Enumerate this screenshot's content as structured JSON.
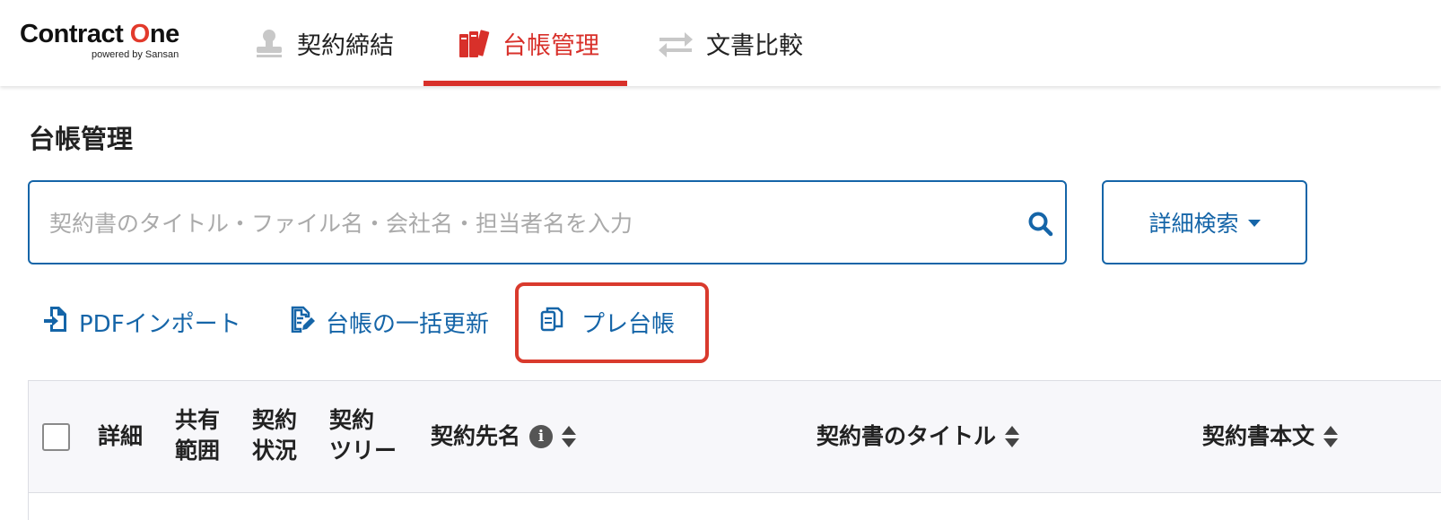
{
  "app": {
    "logo_main_1": "Contract ",
    "logo_main_o": "O",
    "logo_main_2": "ne",
    "logo_sub": "powered by Sansan"
  },
  "nav": {
    "tabs": [
      {
        "label": "契約締結",
        "icon": "stamp-icon",
        "active": false
      },
      {
        "label": "台帳管理",
        "icon": "ledger-books-icon",
        "active": true
      },
      {
        "label": "文書比較",
        "icon": "compare-arrows-icon",
        "active": false
      }
    ]
  },
  "page": {
    "title": "台帳管理"
  },
  "search": {
    "placeholder": "契約書のタイトル・ファイル名・会社名・担当者名を入力",
    "value": "",
    "advanced_label": "詳細検索"
  },
  "actions": [
    {
      "label": "PDFインポート",
      "icon": "file-import-icon"
    },
    {
      "label": "台帳の一括更新",
      "icon": "file-edit-icon"
    },
    {
      "label": "プレ台帳",
      "icon": "copy-documents-icon",
      "highlighted": true
    }
  ],
  "table": {
    "columns": [
      {
        "line1": "詳細",
        "line2": ""
      },
      {
        "line1": "共有",
        "line2": "範囲"
      },
      {
        "line1": "契約",
        "line2": "状況"
      },
      {
        "line1": "契約",
        "line2": "ツリー"
      },
      {
        "label": "契約先名",
        "info": "i",
        "sortable": true
      },
      {
        "label": "契約書のタイトル",
        "sortable": true
      },
      {
        "label": "契約書本文",
        "sortable": true
      }
    ]
  },
  "colors": {
    "accent_red": "#d8302a",
    "link_blue": "#1565a8",
    "highlight_red": "#d93a2d"
  }
}
